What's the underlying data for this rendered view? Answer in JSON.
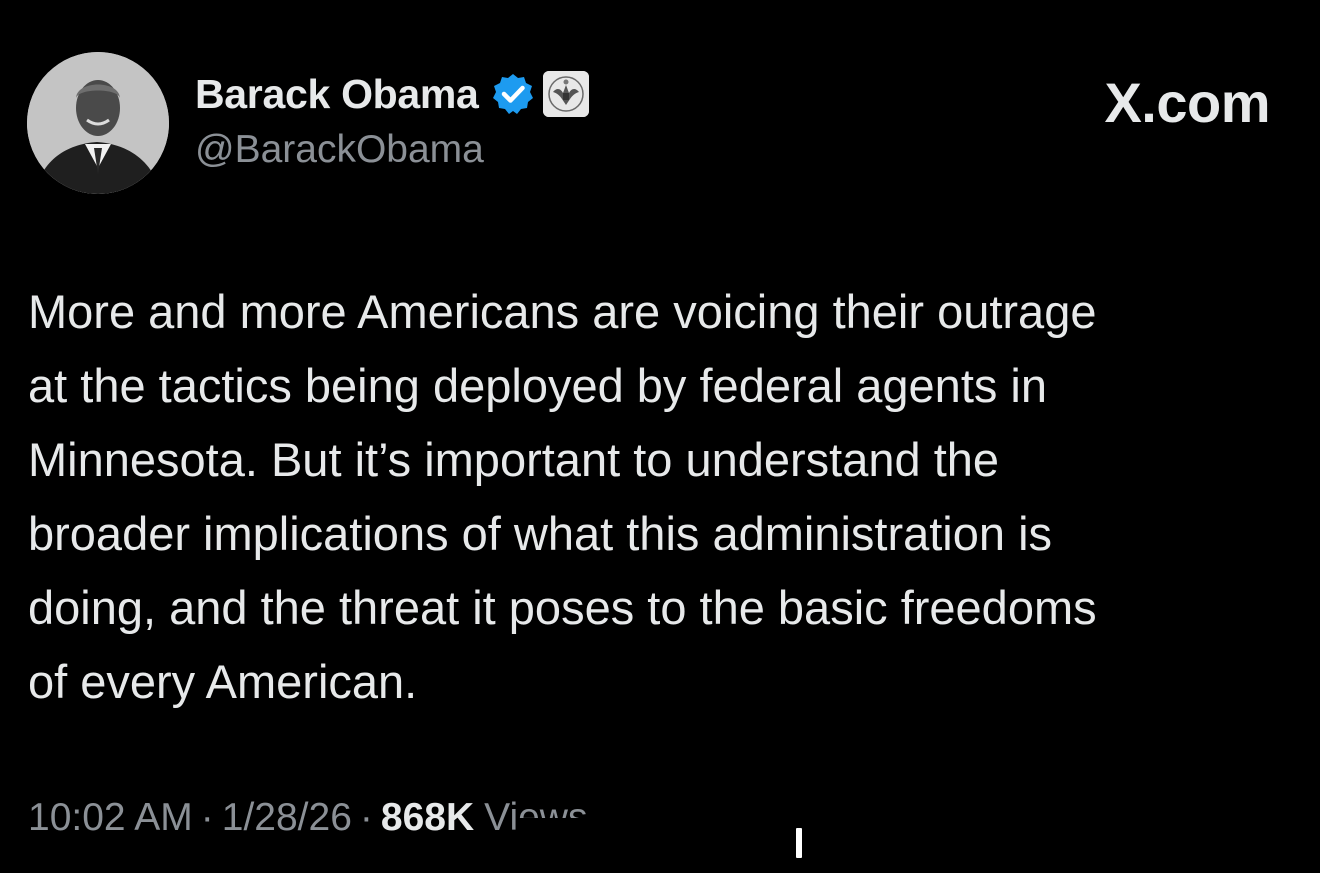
{
  "author": {
    "display_name": "Barack Obama",
    "handle": "@BarackObama",
    "verified_icon": "verified-check-icon",
    "affiliation_icon": "government-seal-icon",
    "verified_color": "#1d9bf0"
  },
  "source": {
    "label": "X.com"
  },
  "tweet": {
    "lines": [
      "More and more Americans are voicing their outrage",
      "at the tactics being deployed by federal agents in",
      "Minnesota. But it’s important to understand the",
      "broader implications of what this administration is",
      "doing, and the threat it poses to the basic freedoms",
      "of every American."
    ]
  },
  "meta": {
    "time": "10:02 AM",
    "separator": "·",
    "date": "1/28/26",
    "views_count": "868K",
    "views_label": "Views"
  },
  "colors": {
    "background": "#000000",
    "primary_text": "#e7e9ea",
    "secondary_text": "#8b9096"
  }
}
